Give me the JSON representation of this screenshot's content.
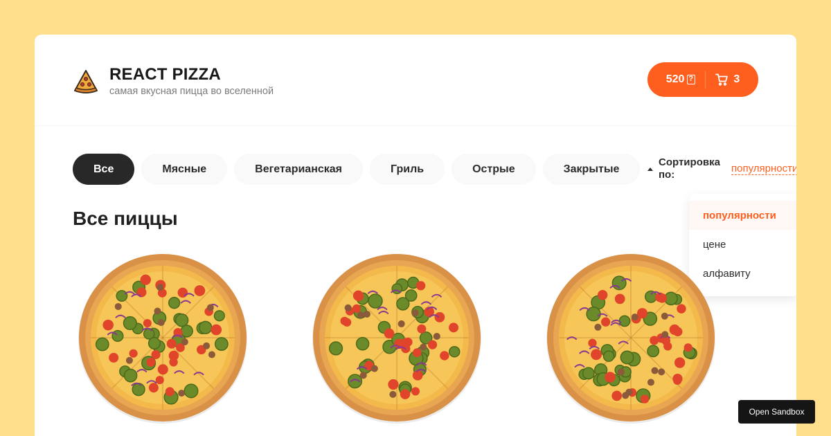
{
  "header": {
    "title": "REACT PIZZA",
    "subtitle": "самая вкусная пицца во вселенной",
    "cart": {
      "price": "520",
      "count": "3"
    }
  },
  "categories": [
    "Все",
    "Мясные",
    "Вегетарианская",
    "Гриль",
    "Острые",
    "Закрытые"
  ],
  "sort": {
    "label": "Сортировка по:",
    "selected": "популярности",
    "options": [
      "популярности",
      "цене",
      "алфавиту"
    ]
  },
  "main": {
    "title": "Все пиццы"
  },
  "sandbox_label": "Open Sandbox",
  "colors": {
    "accent": "#fe5f1e",
    "background": "#ffdf8c",
    "dark": "#282828"
  }
}
